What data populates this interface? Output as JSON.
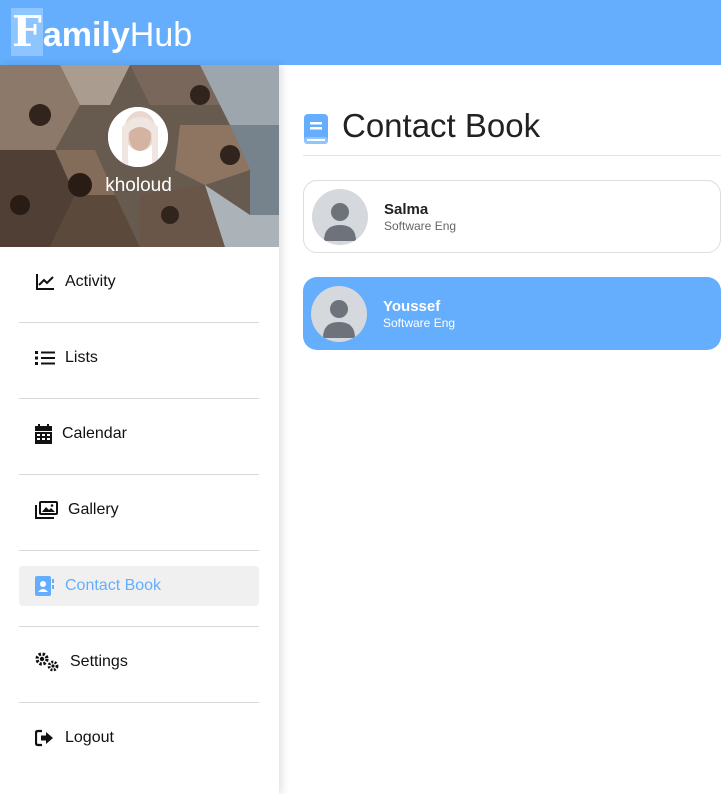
{
  "header": {
    "logo_initial": "F",
    "logo_bold": "amily",
    "logo_light": "Hub",
    "background": "#64aefd"
  },
  "profile": {
    "name": "kholoud"
  },
  "menu": [
    {
      "label": "Activity",
      "icon": "chart-line-icon",
      "active": false
    },
    {
      "label": "Lists",
      "icon": "list-icon",
      "active": false
    },
    {
      "label": "Calendar",
      "icon": "calendar-icon",
      "active": false
    },
    {
      "label": "Gallery",
      "icon": "gallery-icon",
      "active": false
    },
    {
      "label": "Contact Book",
      "icon": "contact-book-icon",
      "active": true
    },
    {
      "label": "Settings",
      "icon": "gears-icon",
      "active": false
    },
    {
      "label": "Logout",
      "icon": "logout-icon",
      "active": false
    }
  ],
  "main": {
    "title": "Contact Book",
    "title_icon": "address-book-icon",
    "contacts": [
      {
        "name": "Salma",
        "role": "Software Eng",
        "selected": false
      },
      {
        "name": "Youssef",
        "role": "Software Eng",
        "selected": true
      }
    ]
  },
  "colors": {
    "accent": "#64aefd",
    "active_menu_bg": "#f0f0f0"
  }
}
